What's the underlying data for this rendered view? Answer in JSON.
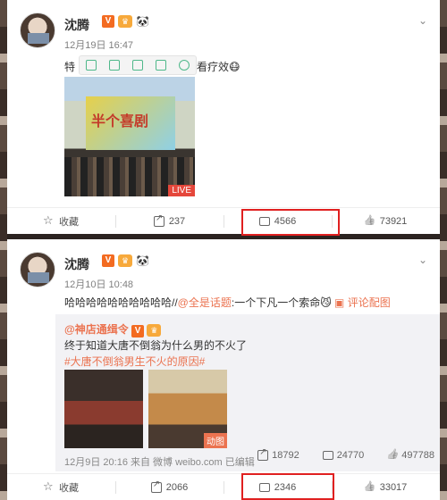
{
  "post1": {
    "author": "沈腾",
    "time": "12月19日 16:47",
    "text_start": "特",
    "text_end": "看疗效",
    "media_badge": "LIVE",
    "image_title": "半个喜剧",
    "actions": {
      "favorite": "收藏",
      "share": "237",
      "comment": "4566",
      "like": "73921"
    }
  },
  "post2": {
    "author": "沈腾",
    "time": "12月10日 10:48",
    "text": "哈哈哈哈哈哈哈哈哈哈//",
    "mention": "@全是话题",
    "text_tail": ":一个下凡一个索命",
    "comment_pic": "评论配图",
    "repost": {
      "user": "@神店通缉令",
      "line1": "终于知道大唐不倒翁为什么男的不火了",
      "topic": "#大唐不倒翁男生不火的原因#",
      "gif_badge": "动图",
      "meta": "12月9日 20:16 来自 微博 weibo.com 已编辑",
      "share": "18792",
      "comment": "24770",
      "like": "497788"
    },
    "actions": {
      "favorite": "收藏",
      "share": "2066",
      "comment": "2346",
      "like": "33017"
    }
  },
  "colors": {
    "highlight": "#e02020",
    "link": "#eb7350",
    "verified": "#f36b21"
  },
  "icons": [
    "star-icon",
    "share-icon",
    "comment-icon",
    "like-icon",
    "chevron-down-icon"
  ]
}
